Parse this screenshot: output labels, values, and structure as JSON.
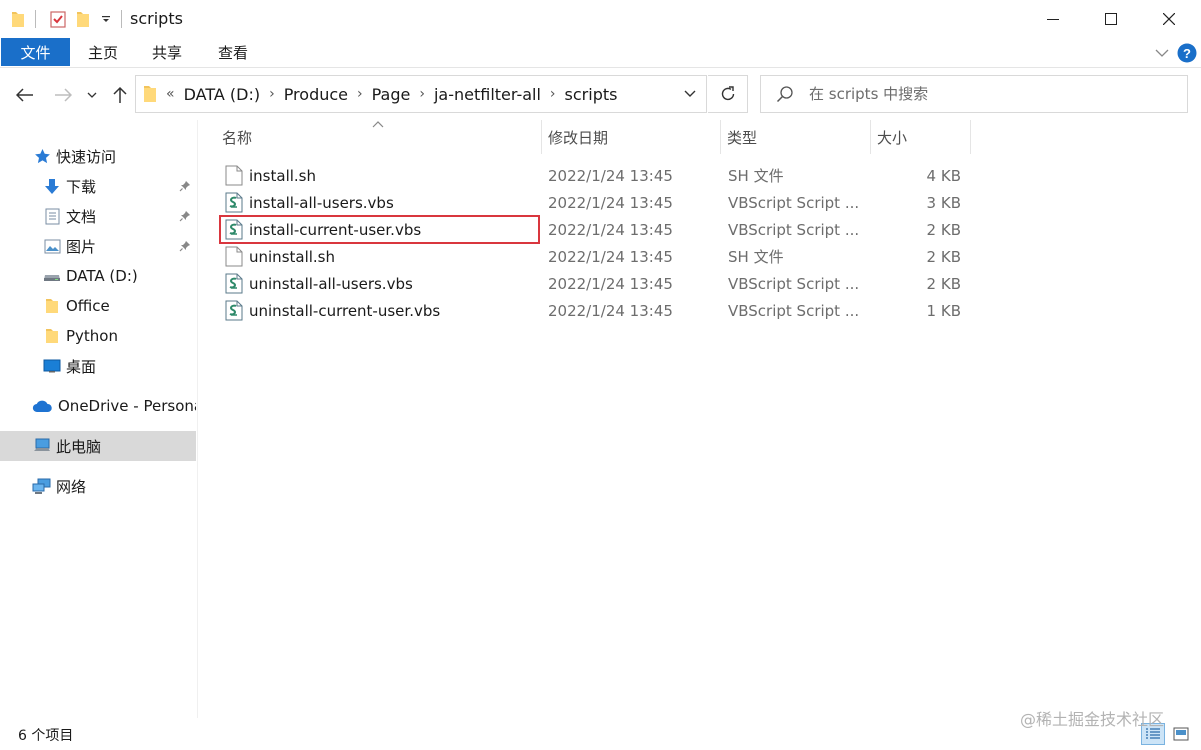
{
  "window": {
    "title": "scripts",
    "controls": {
      "minimize": "minimize-icon",
      "maximize": "maximize-icon",
      "close": "close-icon"
    }
  },
  "ribbon": {
    "tabs": [
      {
        "label": "文件",
        "active": true
      },
      {
        "label": "主页"
      },
      {
        "label": "共享"
      },
      {
        "label": "查看"
      }
    ]
  },
  "address": {
    "overflow": "«",
    "crumbs": [
      "DATA (D:)",
      "Produce",
      "Page",
      "ja-netfilter-all",
      "scripts"
    ]
  },
  "search": {
    "placeholder": "在 scripts 中搜索"
  },
  "sidebar": {
    "items": [
      {
        "label": "快速访问",
        "icon": "star-icon",
        "pinned": false
      },
      {
        "label": "下载",
        "icon": "download-icon",
        "pinned": true
      },
      {
        "label": "文档",
        "icon": "document-icon",
        "pinned": true
      },
      {
        "label": "图片",
        "icon": "picture-icon",
        "pinned": true
      },
      {
        "label": "DATA (D:)",
        "icon": "drive-icon",
        "pinned": false
      },
      {
        "label": "Office",
        "icon": "folder-icon",
        "pinned": false
      },
      {
        "label": "Python",
        "icon": "folder-icon",
        "pinned": false
      },
      {
        "label": "桌面",
        "icon": "desktop-icon",
        "pinned": false
      },
      {
        "label": "OneDrive - Persona",
        "icon": "cloud-icon",
        "pinned": false
      },
      {
        "label": "此电脑",
        "icon": "computer-icon",
        "pinned": false,
        "selected": true
      },
      {
        "label": "网络",
        "icon": "network-icon",
        "pinned": false
      }
    ]
  },
  "columns": {
    "name": "名称",
    "date": "修改日期",
    "type": "类型",
    "size": "大小"
  },
  "files": [
    {
      "name": "install.sh",
      "date": "2022/1/24 13:45",
      "type": "SH 文件",
      "size": "4 KB",
      "icon": "sh-file-icon"
    },
    {
      "name": "install-all-users.vbs",
      "date": "2022/1/24 13:45",
      "type": "VBScript Script ...",
      "size": "3 KB",
      "icon": "vbs-file-icon"
    },
    {
      "name": "install-current-user.vbs",
      "date": "2022/1/24 13:45",
      "type": "VBScript Script ...",
      "size": "2 KB",
      "icon": "vbs-file-icon",
      "highlighted": true
    },
    {
      "name": "uninstall.sh",
      "date": "2022/1/24 13:45",
      "type": "SH 文件",
      "size": "2 KB",
      "icon": "sh-file-icon"
    },
    {
      "name": "uninstall-all-users.vbs",
      "date": "2022/1/24 13:45",
      "type": "VBScript Script ...",
      "size": "2 KB",
      "icon": "vbs-file-icon"
    },
    {
      "name": "uninstall-current-user.vbs",
      "date": "2022/1/24 13:45",
      "type": "VBScript Script ...",
      "size": "1 KB",
      "icon": "vbs-file-icon"
    }
  ],
  "status": {
    "count": "6 个项目"
  },
  "watermark": "@稀土掘金技术社区",
  "colors": {
    "accent": "#1a6fc9",
    "highlight": "#d9363e",
    "selected": "#d9d9d9"
  }
}
